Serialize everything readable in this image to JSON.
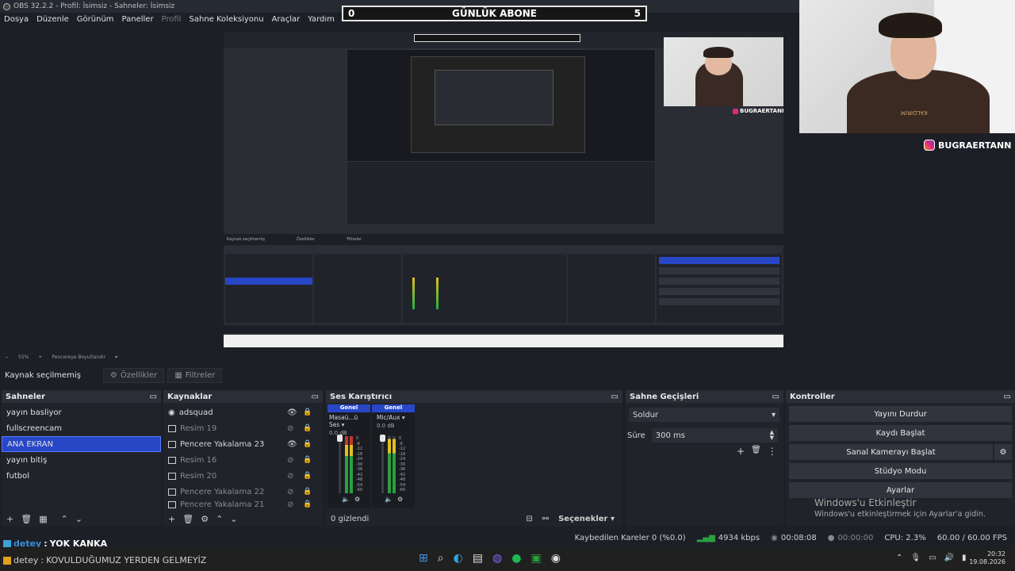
{
  "window": {
    "title": "OBS 32.2.2 - Profil: İsimsiz - Sahneler: İsimsiz"
  },
  "menu": {
    "items": [
      "Dosya",
      "Düzenle",
      "Görünüm",
      "Paneller",
      "Profil",
      "Sahne Koleksiyonu",
      "Araçlar",
      "Yardım"
    ]
  },
  "overlay": {
    "counter_left": "0",
    "counter_title": "GÜNLÜK ABONE",
    "counter_right": "5",
    "instagram_handle": "BUGRAERTANN"
  },
  "zoom": {
    "percent": "55%",
    "mode": "Pencereye Boyutlandır"
  },
  "source_toolbar": {
    "status": "Kaynak seçilmemiş",
    "properties": "Özellikler",
    "filters": "Filtreler"
  },
  "scenes": {
    "title": "Sahneler",
    "items": [
      "yayın basliyor",
      "fullscreencam",
      "ANA EKRAN",
      "yayın bitiş",
      "futbol"
    ],
    "selected_index": 2
  },
  "sources": {
    "title": "Kaynaklar",
    "items": [
      {
        "name": "adsquad",
        "visible": true
      },
      {
        "name": "Resim 19",
        "visible": false
      },
      {
        "name": "Pencere Yakalama 23",
        "visible": true
      },
      {
        "name": "Resim 16",
        "visible": false
      },
      {
        "name": "Resim 20",
        "visible": false
      },
      {
        "name": "Pencere Yakalama 22",
        "visible": false
      },
      {
        "name": "Pencere Yakalama 21",
        "visible": false
      }
    ]
  },
  "mixer": {
    "title": "Ses Karıştırıcı",
    "channels": [
      {
        "header": "Genel",
        "name": "Masaü...ü Ses",
        "db": "0.0 dB"
      },
      {
        "header": "Genel",
        "name": "Mic/Aux",
        "db": "0.0 dB"
      }
    ],
    "scale": [
      "0",
      "-6",
      "-12",
      "-18",
      "-24",
      "-30",
      "-36",
      "-42",
      "-48",
      "-54",
      "-60"
    ],
    "hidden_count": "0 gizlendi",
    "options": "Seçenekler"
  },
  "transitions": {
    "title": "Sahne Geçişleri",
    "selected": "Soldur",
    "duration_label": "Süre",
    "duration_value": "300 ms"
  },
  "controls": {
    "title": "Kontroller",
    "stop_stream": "Yayını Durdur",
    "start_record": "Kaydı Başlat",
    "virtual_cam": "Sanal Kamerayı Başlat",
    "studio_mode": "Stüdyo Modu",
    "settings": "Ayarlar"
  },
  "activation": {
    "title": "Windows'u Etkinleştir",
    "subtitle": "Windows'u etkinleştirmek için Ayarlar'a gidin."
  },
  "status": {
    "dropped_frames": "Kaybedilen Kareler 0 (%0.0)",
    "bitrate": "4934 kbps",
    "stream_time": "00:08:08",
    "record_time": "00:00:00",
    "cpu": "CPU: 2.3%",
    "fps": "60.00 / 60.00 FPS"
  },
  "chat": [
    {
      "user": "detey",
      "message": "YOK KANKA"
    },
    {
      "user": "detey",
      "message": "KOVULDUĞUMUZ YERDEN GELMEYİZ"
    }
  ],
  "taskbar": {
    "time": "20:32",
    "date": "19.08.2026"
  }
}
